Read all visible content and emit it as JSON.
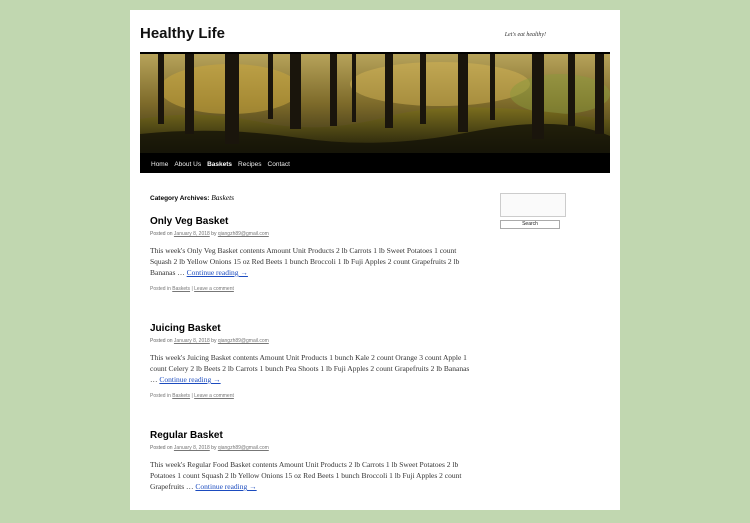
{
  "site": {
    "title": "Healthy Life",
    "description": "Let's eat healthy!"
  },
  "nav": {
    "items": [
      {
        "label": "Home"
      },
      {
        "label": "About Us"
      },
      {
        "label": "Baskets",
        "current": true
      },
      {
        "label": "Recipes"
      },
      {
        "label": "Contact"
      }
    ]
  },
  "archive": {
    "prefix": "Category Archives:",
    "category": "Baskets"
  },
  "posts": [
    {
      "title": "Only Veg Basket",
      "posted_on": "Posted on",
      "date": "January 8, 2018",
      "by": "by",
      "author": "qiangzh89@gmail.com",
      "summary": "This week's Only Veg Basket contents Amount Unit Products 2 lb Carrots 1 lb Sweet Potatoes 1 count Squash 2 lb Yellow Onions 15 oz Red Beets 1 bunch Broccoli 1 lb Fuji Apples 2 count Grapefruits 2 lb Bananas …",
      "continue": "Continue reading →",
      "posted_in": "Posted in",
      "category": "Baskets",
      "separator": "|",
      "comment": "Leave a comment"
    },
    {
      "title": "Juicing Basket",
      "posted_on": "Posted on",
      "date": "January 8, 2018",
      "by": "by",
      "author": "qiangzh89@gmail.com",
      "summary": "This week's Juicing Basket contents Amount Unit Products 1 bunch Kale 2 count Orange 3 count Apple 1 count Celery 2 lb Beets 2 lb Carrots 1 bunch Pea Shoots 1 lb Fuji Apples 2 count Grapefruits 2 lb Bananas …",
      "continue": "Continue reading →",
      "posted_in": "Posted in",
      "category": "Baskets",
      "separator": "|",
      "comment": "Leave a comment"
    },
    {
      "title": "Regular Basket",
      "posted_on": "Posted on",
      "date": "January 8, 2018",
      "by": "by",
      "author": "qiangzh89@gmail.com",
      "summary": "This week's Regular Food Basket contents Amount Unit Products 2 lb Carrots 1 lb Sweet Potatoes 2 lb Potatoes 1 count Squash 2 lb Yellow Onions 15 oz Red Beets 1 bunch Broccoli 1 lb Fuji Apples 2 count Grapefruits …",
      "continue": "Continue reading →"
    }
  ],
  "search": {
    "button_label": "Search",
    "placeholder": ""
  },
  "colors": {
    "background": "#c1d7b0",
    "nav_bar": "#000000",
    "link": "#1b4bbf"
  }
}
